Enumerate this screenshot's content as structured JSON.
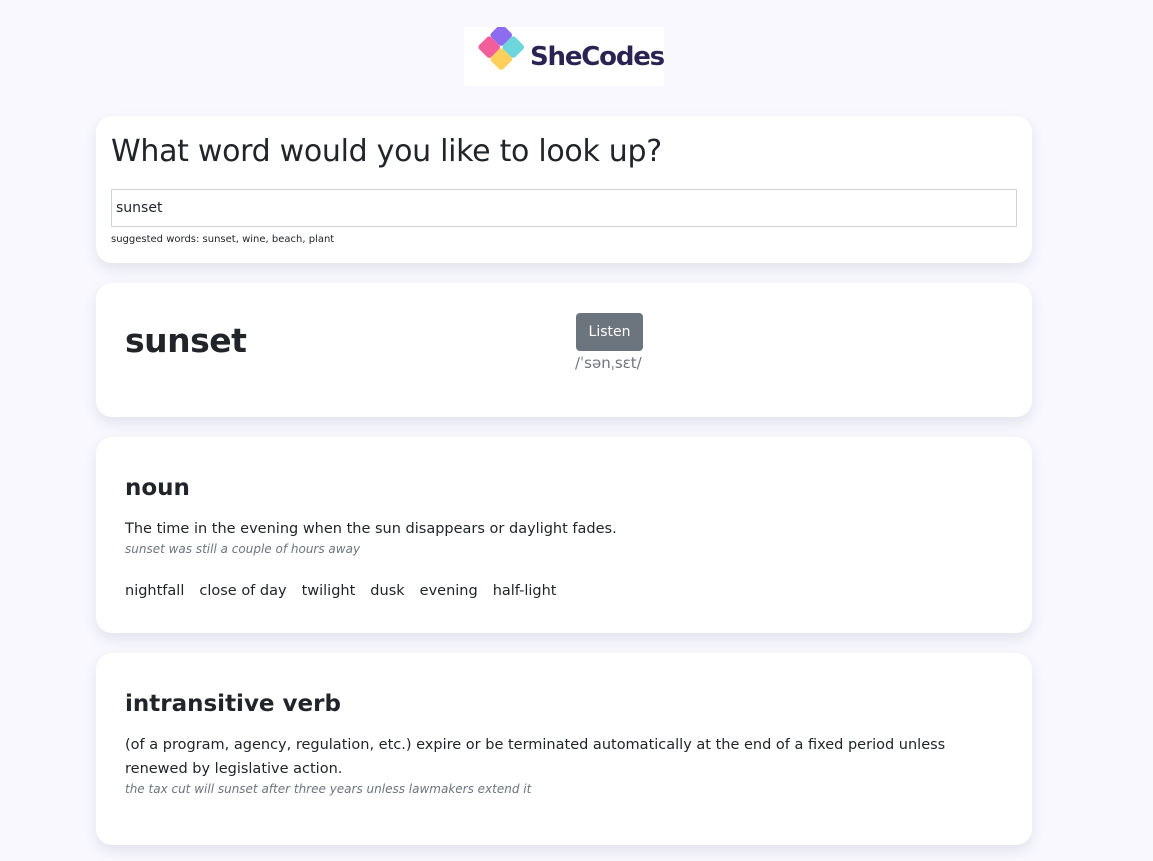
{
  "brand": {
    "name": "SheCodes"
  },
  "search": {
    "title": "What word would you like to look up?",
    "value": "sunset",
    "hint": "suggested words: sunset, wine, beach, plant"
  },
  "word": {
    "text": "sunset",
    "listen_label": "Listen",
    "phonetic": "/ˈsənˌsɛt/"
  },
  "meanings": [
    {
      "part_of_speech": "noun",
      "definition": "The time in the evening when the sun disappears or daylight fades.",
      "example": "sunset was still a couple of hours away",
      "synonyms": [
        "nightfall",
        "close of day",
        "twilight",
        "dusk",
        "evening",
        "half-light"
      ]
    },
    {
      "part_of_speech": "intransitive verb",
      "definition": "(of a program, agency, regulation, etc.) expire or be terminated automatically at the end of a fixed period unless renewed by legislative action.",
      "example": "the tax cut will sunset after three years unless lawmakers extend it"
    }
  ],
  "colors": {
    "background": "#f8f8fe",
    "card": "#ffffff",
    "button": "#6c757d",
    "logo_text": "#2b2452"
  }
}
